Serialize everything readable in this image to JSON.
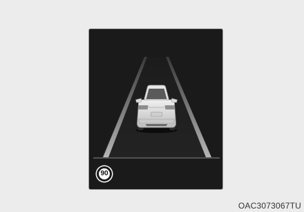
{
  "display": {
    "speed_limit": "90"
  },
  "caption": "OAC3073067TU",
  "colors": {
    "background": "#ececec",
    "screen": "#1a1a1a",
    "lane_lines": "#9a9a9a",
    "car_body": "#d8d8d8"
  },
  "icons": {
    "vehicle": "vehicle-ahead-icon",
    "speed_sign": "speed-limit-sign-icon"
  }
}
